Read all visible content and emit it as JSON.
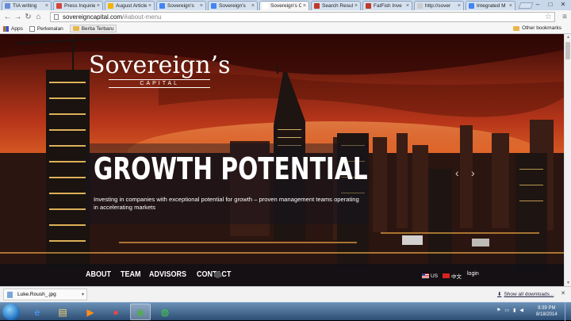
{
  "tabs": [
    {
      "label": "TIA writing",
      "favicon": "#6b8bd6"
    },
    {
      "label": "Press Inquiries",
      "favicon": "#d44638"
    },
    {
      "label": "August Articles",
      "favicon": "#f4b400"
    },
    {
      "label": "Sovereign's",
      "favicon": "#4285f4"
    },
    {
      "label": "Sovereign's",
      "favicon": "#4285f4"
    },
    {
      "label": "Sovereign's C",
      "favicon": "#ffffff",
      "active": true
    },
    {
      "label": "Search Results",
      "favicon": "#c0392b"
    },
    {
      "label": "FatFish Inve",
      "favicon": "#c0392b"
    },
    {
      "label": "http://sover",
      "favicon": "#cccccc"
    },
    {
      "label": "Integrated M",
      "favicon": "#4285f4"
    }
  ],
  "address": {
    "host": "sovereigncapital.com",
    "path": "/#about-menu"
  },
  "bookmarks": {
    "apps_label": "Apps",
    "items": [
      "Perkenalan",
      "Berita Terbaru"
    ],
    "other_label": "Other bookmarks"
  },
  "page": {
    "brand_name": "Sovereign’s",
    "brand_sub": "CAPITAL",
    "hero_title": "GROWTH POTENTIAL",
    "hero_desc": "Investing in companies with exceptional potential for growth – proven management teams operating in accelerating markets",
    "nav": [
      "ABOUT",
      "TEAM",
      "ADVISORS",
      "CONTACT"
    ],
    "lang_us": "US",
    "lang_cn": "中文",
    "login": "login"
  },
  "downloads": {
    "file": "Luke.Roush_.jpg",
    "show_all": "Show all downloads..."
  },
  "taskbar": {
    "time": "9:39 PM",
    "date": "8/18/2014"
  },
  "colors": {
    "sky_top": "#4a0d08",
    "sky_glow": "#ff9a3c",
    "navbar": "#0f0f14"
  }
}
